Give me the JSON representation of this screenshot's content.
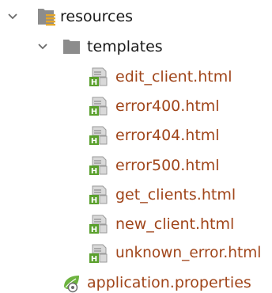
{
  "tree": {
    "root": {
      "label": "resources",
      "icon": "resources-folder-icon",
      "expanded": true
    },
    "subfolder": {
      "label": "templates",
      "icon": "folder-icon",
      "expanded": true
    },
    "template_files": [
      {
        "label": "edit_client.html",
        "icon": "html-file-icon"
      },
      {
        "label": "error400.html",
        "icon": "html-file-icon"
      },
      {
        "label": "error404.html",
        "icon": "html-file-icon"
      },
      {
        "label": "error500.html",
        "icon": "html-file-icon"
      },
      {
        "label": "get_clients.html",
        "icon": "html-file-icon"
      },
      {
        "label": "new_client.html",
        "icon": "html-file-icon"
      },
      {
        "label": "unknown_error.html",
        "icon": "html-file-icon"
      }
    ],
    "properties_file": {
      "label": "application.properties",
      "icon": "spring-properties-icon"
    }
  },
  "colors": {
    "file_text": "#a0451a",
    "folder_text": "#1a1a1a",
    "html_badge": "#5aa02c",
    "folder_gray": "#8c8c8c",
    "resource_lines": "#e6a72a",
    "spring_green": "#6db33f"
  }
}
